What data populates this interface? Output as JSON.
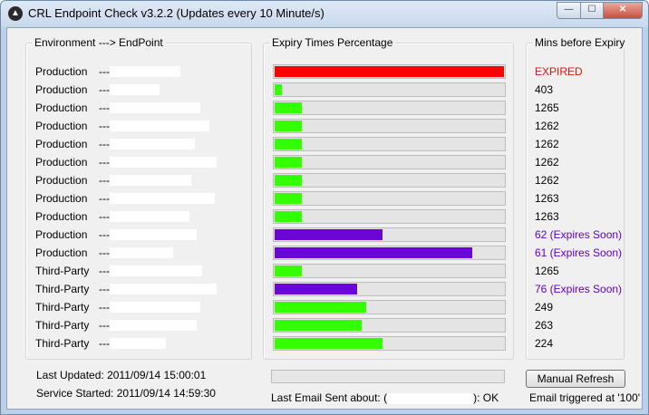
{
  "window": {
    "title": "CRL Endpoint Check v3.2.2 (Updates every 10 Minute/s)",
    "icon": "app-logo-icon",
    "controls": {
      "minimize": "—",
      "maximize": "☐",
      "close": "✕"
    }
  },
  "groups": {
    "environment_title": "Environment ---> EndPoint",
    "expiry_title": "Expiry Times Percentage",
    "mins_title": "Mins before Expiry"
  },
  "arrow": "--->",
  "colors": {
    "expired": "#e81010",
    "ok": "#39ff00",
    "soon": "#6400cc",
    "bar_red": "#ff0000",
    "bar_green": "#33ff00",
    "bar_purple": "#6a06d6"
  },
  "rows": [
    {
      "env": "Production",
      "pct": 100,
      "bar": "red",
      "mins": "EXPIRED",
      "status": "expired"
    },
    {
      "env": "Production",
      "pct": 3,
      "bar": "green",
      "mins": "403",
      "status": "normal"
    },
    {
      "env": "Production",
      "pct": 12,
      "bar": "green",
      "mins": "1265",
      "status": "normal"
    },
    {
      "env": "Production",
      "pct": 12,
      "bar": "green",
      "mins": "1262",
      "status": "normal"
    },
    {
      "env": "Production",
      "pct": 12,
      "bar": "green",
      "mins": "1262",
      "status": "normal"
    },
    {
      "env": "Production",
      "pct": 12,
      "bar": "green",
      "mins": "1262",
      "status": "normal"
    },
    {
      "env": "Production",
      "pct": 12,
      "bar": "green",
      "mins": "1262",
      "status": "normal"
    },
    {
      "env": "Production",
      "pct": 12,
      "bar": "green",
      "mins": "1263",
      "status": "normal"
    },
    {
      "env": "Production",
      "pct": 12,
      "bar": "green",
      "mins": "1263",
      "status": "normal"
    },
    {
      "env": "Production",
      "pct": 47,
      "bar": "purple",
      "mins": "62 (Expires Soon)",
      "status": "soon"
    },
    {
      "env": "Production",
      "pct": 86,
      "bar": "purple",
      "mins": "61 (Expires Soon)",
      "status": "soon"
    },
    {
      "env": "Third-Party",
      "pct": 12,
      "bar": "green",
      "mins": "1265",
      "status": "normal"
    },
    {
      "env": "Third-Party",
      "pct": 36,
      "bar": "purple",
      "mins": "76 (Expires Soon)",
      "status": "soon"
    },
    {
      "env": "Third-Party",
      "pct": 40,
      "bar": "green",
      "mins": "249",
      "status": "normal"
    },
    {
      "env": "Third-Party",
      "pct": 38,
      "bar": "green",
      "mins": "263",
      "status": "normal"
    },
    {
      "env": "Third-Party",
      "pct": 47,
      "bar": "green",
      "mins": "224",
      "status": "normal"
    }
  ],
  "footer": {
    "last_updated_label": "Last Updated:",
    "last_updated_value": "2011/09/14 15:00:01",
    "service_started_label": "Service Started:",
    "service_started_value": "2011/09/14 14:59:30",
    "last_email_prefix": "Last Email Sent about: (",
    "last_email_suffix": "): OK",
    "email_trigger": "Email triggered at '100'",
    "manual_refresh_label": "Manual Refresh"
  }
}
